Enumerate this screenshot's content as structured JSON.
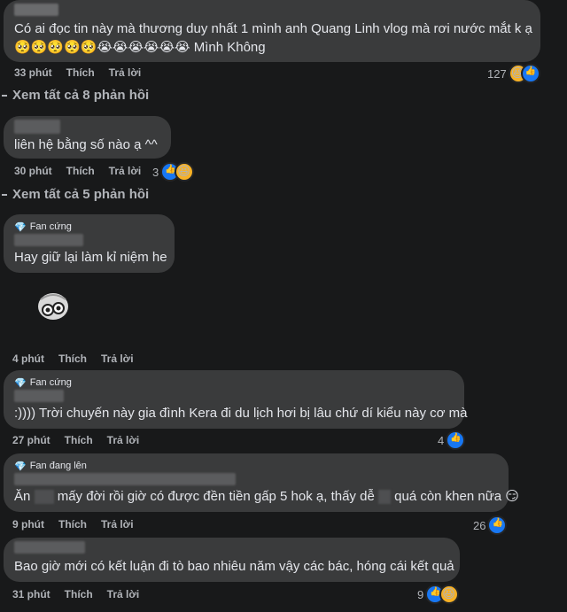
{
  "comments": [
    {
      "text_line1": "Có ai đọc tin này mà thương duy nhất 1 mình anh Quang Linh vlog mà rơi nước mắt k ạ",
      "text_line2_emoji": "🥺🥺🥺🥺🥺😭😭😭😭😭😭",
      "text_line2_suffix": "Mình Không",
      "time": "33 phút",
      "like": "Thích",
      "reply": "Trả lời",
      "reaction_count": "127"
    },
    {
      "text": "liên hệ bằng số nào ạ ^^",
      "time": "30 phút",
      "like": "Thích",
      "reply": "Trả lời",
      "reaction_count": "3"
    },
    {
      "badge": "Fan cứng",
      "text": "Hay giữ lại làm kỉ niệm he",
      "time": "4 phút",
      "like": "Thích",
      "reply": "Trả lời"
    },
    {
      "badge": "Fan cứng",
      "text": ":)))) Trời chuyến này gia đình Kera đi du lịch hơi bị lâu chứ dí kiểu này cơ mà",
      "time": "27 phút",
      "like": "Thích",
      "reply": "Trả lời",
      "reaction_count": "4"
    },
    {
      "badge": "Fan đang lên",
      "text_a": "Ăn",
      "text_b": "mấy đời rồi giờ có được đền tiền gấp 5 hok ạ, thấy dễ",
      "text_c": "quá còn khen nữa",
      "time": "9 phút",
      "like": "Thích",
      "reply": "Trả lời",
      "reaction_count": "26"
    },
    {
      "text": "Bao giờ mới có kết luận đi tò bao nhiêu năm vậy các bác, hóng cái kết quả",
      "time": "31 phút",
      "like": "Thích",
      "reply": "Trả lời",
      "reaction_count": "9"
    }
  ],
  "view_replies": [
    {
      "label": "Xem tất cả 8 phản hồi"
    },
    {
      "label": "Xem tất cả 5 phản hồi"
    }
  ],
  "colors": {
    "background": "#18191a",
    "bubble": "#3a3b3c",
    "secondary_text": "#b0b3b8",
    "like_blue": "#1877f2"
  }
}
